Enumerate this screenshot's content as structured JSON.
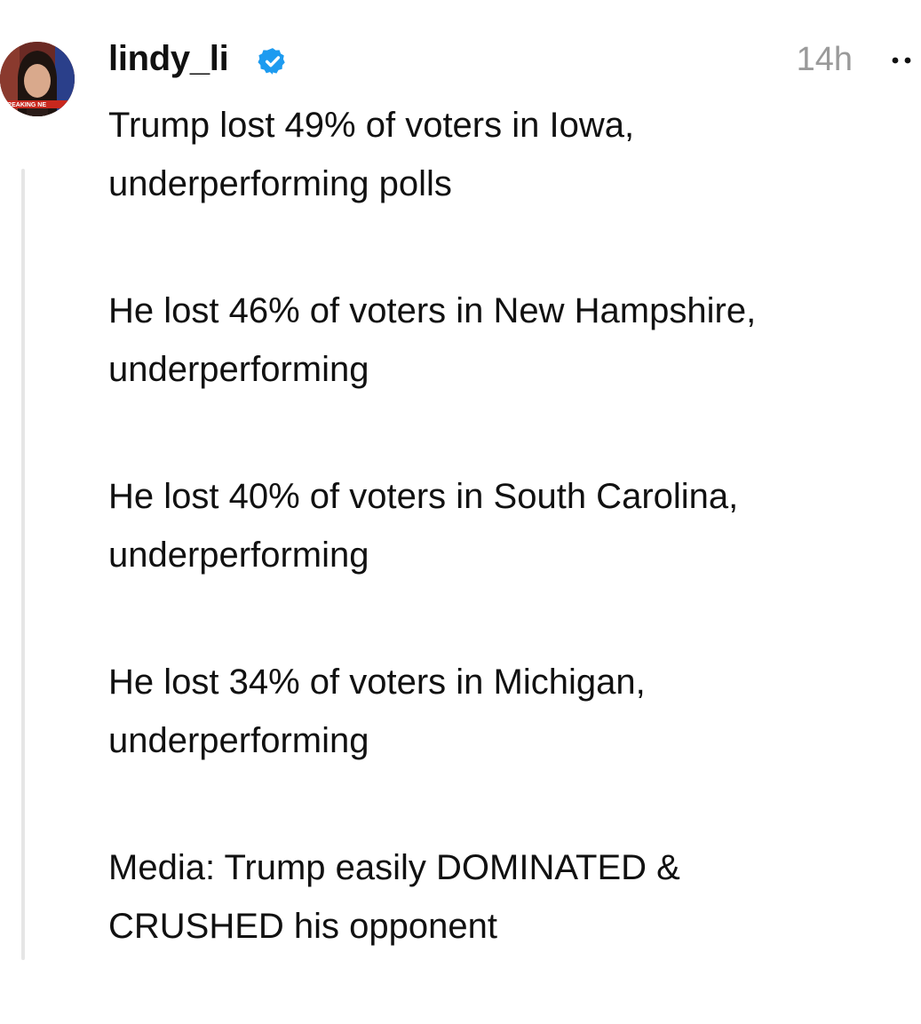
{
  "post": {
    "username": "lindy_li",
    "verified": true,
    "timestamp": "14h",
    "avatar_badge_text": "BREAKING NE",
    "paragraphs": [
      "Trump lost 49% of voters in Iowa,\nunderperforming polls",
      "He lost 46% of voters in New Hampshire,\nunderperforming",
      "He lost 40% of voters in South Carolina,\nunderperforming",
      "He lost 34% of voters in Michigan,\nunderperforming",
      "Media: Trump easily DOMINATED &\nCRUSHED his opponent"
    ]
  },
  "icons": {
    "verified": "verified-badge-icon",
    "more": "more-options-icon"
  },
  "colors": {
    "verified_blue": "#1d9bf0",
    "timestamp_gray": "#9a9a9a",
    "thread_line": "#e6e6e6",
    "text": "#111111"
  }
}
